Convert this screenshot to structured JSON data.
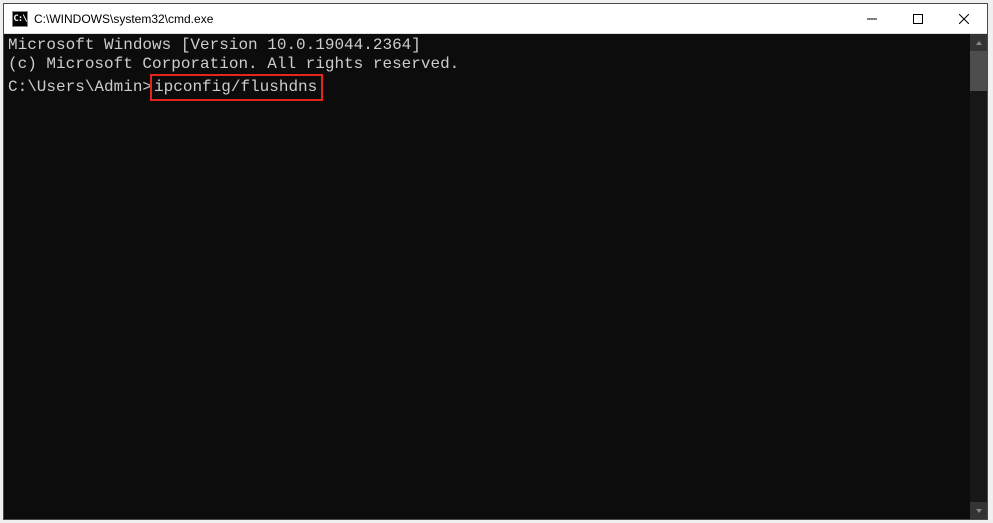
{
  "window": {
    "icon_label": "C:\\",
    "title": "C:\\WINDOWS\\system32\\cmd.exe"
  },
  "console": {
    "line1": "Microsoft Windows [Version 10.0.19044.2364]",
    "line2": "(c) Microsoft Corporation. All rights reserved.",
    "blank": "",
    "prompt": "C:\\Users\\Admin>",
    "command": "ipconfig/flushdns"
  }
}
